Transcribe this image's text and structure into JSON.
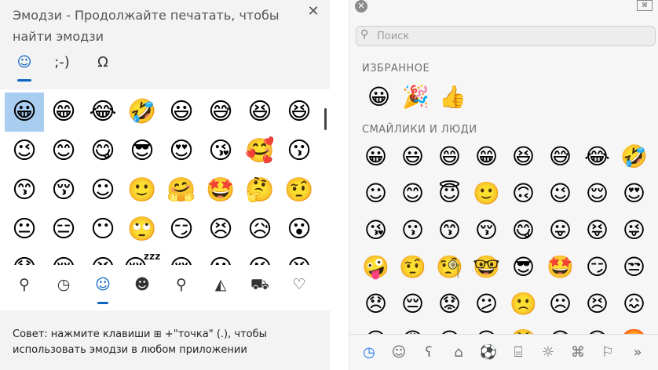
{
  "windows_panel": {
    "title": "Эмодзи - Продолжайте печатать, чтобы найти эмодзи",
    "close_glyph": "✕",
    "tabs": [
      {
        "icon": "smiley-tab-icon",
        "glyph": "☺",
        "active": true
      },
      {
        "icon": "kaomoji-tab-icon",
        "glyph": ";-)",
        "active": false
      },
      {
        "icon": "symbols-tab-icon",
        "glyph": "Ω",
        "active": false
      }
    ],
    "emoji_grid": [
      "😀",
      "😁",
      "😂",
      "🤣",
      "😃",
      "😅",
      "😆",
      "😆",
      "😉",
      "😊",
      "😋",
      "😎",
      "😍",
      "😘",
      "🥰",
      "😗",
      "😙",
      "😚",
      "☺",
      "🙂",
      "🤗",
      "🤩",
      "🤔",
      "🤨",
      "😐",
      "😑",
      "😶",
      "🙄",
      "😏",
      "😣",
      "😥",
      "😮",
      "😯",
      "😪",
      "😫",
      "😴",
      "😌",
      "😛",
      "😜",
      "😝"
    ],
    "selected_index": 0,
    "categories": [
      {
        "icon": "search-icon",
        "glyph": "⚲",
        "active": false
      },
      {
        "icon": "recent-clock-icon",
        "glyph": "◷",
        "active": false
      },
      {
        "icon": "smileys-icon",
        "glyph": "☺",
        "active": true
      },
      {
        "icon": "people-icon",
        "glyph": "☻",
        "active": false
      },
      {
        "icon": "celebration-balloon-icon",
        "glyph": "⚲",
        "active": false
      },
      {
        "icon": "food-pizza-icon",
        "glyph": "◭",
        "active": false
      },
      {
        "icon": "travel-car-icon",
        "glyph": "⛟",
        "active": false
      },
      {
        "icon": "heart-icon",
        "glyph": "♡",
        "active": false
      }
    ],
    "tip_prefix": "Совет: нажмите клавиши",
    "tip_key_glyph": "⊞",
    "tip_suffix": "+\"точка\" (.), чтобы использовать эмодзи в любом приложении",
    "accent_color": "#0a64c4",
    "selected_color": "#a9cdf0"
  },
  "mac_panel": {
    "close_glyph": "✕",
    "viewer_glyph": "⌘",
    "search_placeholder": "Поиск",
    "search_icon": "magnifier-icon",
    "favorites_label": "ИЗБРАННОЕ",
    "favorites": [
      "😀",
      "🎉",
      "👍"
    ],
    "smileys_label": "СМАЙЛИКИ И ЛЮДИ",
    "emoji_grid": [
      "😀",
      "😃",
      "😄",
      "😁",
      "😆",
      "😅",
      "😂",
      "🤣",
      "☺",
      "😊",
      "😇",
      "🙂",
      "🙃",
      "😉",
      "😌",
      "😍",
      "😘",
      "😗",
      "😙",
      "😚",
      "😋",
      "😛",
      "😝",
      "😜",
      "🤪",
      "🤨",
      "🧐",
      "🤓",
      "😎",
      "🤩",
      "😏",
      "😒",
      "😞",
      "😔",
      "😟",
      "😕",
      "🙁",
      "☹",
      "😣",
      "😖",
      "😫",
      "😩",
      "😢",
      "😭",
      "😤",
      "😠",
      "😡",
      "🤬"
    ],
    "categories": [
      {
        "icon": "recent-clock-icon",
        "glyph": "◷",
        "active": true
      },
      {
        "icon": "smileys-icon",
        "glyph": "☺",
        "active": false
      },
      {
        "icon": "animals-bear-icon",
        "glyph": "ʕ",
        "active": false
      },
      {
        "icon": "food-cake-icon",
        "glyph": "⌂",
        "active": false
      },
      {
        "icon": "activity-ball-icon",
        "glyph": "⚽",
        "active": false
      },
      {
        "icon": "travel-building-icon",
        "glyph": "⌸",
        "active": false
      },
      {
        "icon": "objects-bulb-icon",
        "glyph": "☼",
        "active": false
      },
      {
        "icon": "symbols-icon",
        "glyph": "⌘",
        "active": false
      },
      {
        "icon": "flags-icon",
        "glyph": "⚐",
        "active": false
      },
      {
        "icon": "more-chevrons-icon",
        "glyph": "»",
        "active": false
      }
    ],
    "accent_color": "#1a73e8"
  }
}
